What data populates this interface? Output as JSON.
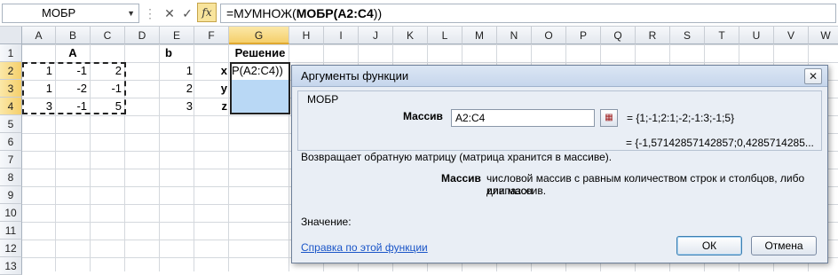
{
  "formula_bar": {
    "name_box": "МОБР",
    "cancel_symbol": "✕",
    "enter_symbol": "✓",
    "fx_label": "fx",
    "formula_prefix": "=МУМНОЖ(",
    "formula_bold": "МОБР",
    "formula_paren": "(",
    "formula_ref": "A2:C4",
    "formula_suffix": "))"
  },
  "columns": [
    "A",
    "B",
    "C",
    "D",
    "E",
    "F",
    "G",
    "H",
    "I",
    "J",
    "K",
    "L",
    "M",
    "N",
    "O",
    "P",
    "Q",
    "R",
    "S",
    "T",
    "U",
    "V",
    "W"
  ],
  "rows": [
    "1",
    "2",
    "3",
    "4",
    "5",
    "6",
    "7",
    "8",
    "9",
    "10",
    "11",
    "12",
    "13"
  ],
  "cells": {
    "B1": "A",
    "E1": "b",
    "G1": "Решение",
    "A2": "1",
    "B2": "-1",
    "C2": "2",
    "A3": "1",
    "B3": "-2",
    "C3": "-1",
    "A4": "3",
    "B4": "-1",
    "C4": "5",
    "E2": "1",
    "E3": "2",
    "E4": "3",
    "F2": "x",
    "F3": "y",
    "F4": "z",
    "G2": "Р(A2:C4))"
  },
  "dialog": {
    "title": "Аргументы функции",
    "close_symbol": "✕",
    "function_name": "МОБР",
    "arg_label": "Массив",
    "arg_value": "A2:C4",
    "arg_result": "=  {1;-1;2:1;-2;-1:3;-1;5}",
    "result_preview": "=  {-1,57142857142857;0,4285714285...",
    "description": "Возвращает обратную матрицу (матрица хранится в массиве).",
    "arg_desc_label": "Массив",
    "arg_desc_line1": "числовой массив с равным количеством строк и столбцов, либо диапазон",
    "arg_desc_line2": "или массив.",
    "value_label": "Значение:",
    "help_link": "Справка по этой функции",
    "ok_label": "ОК",
    "cancel_label": "Отмена"
  }
}
